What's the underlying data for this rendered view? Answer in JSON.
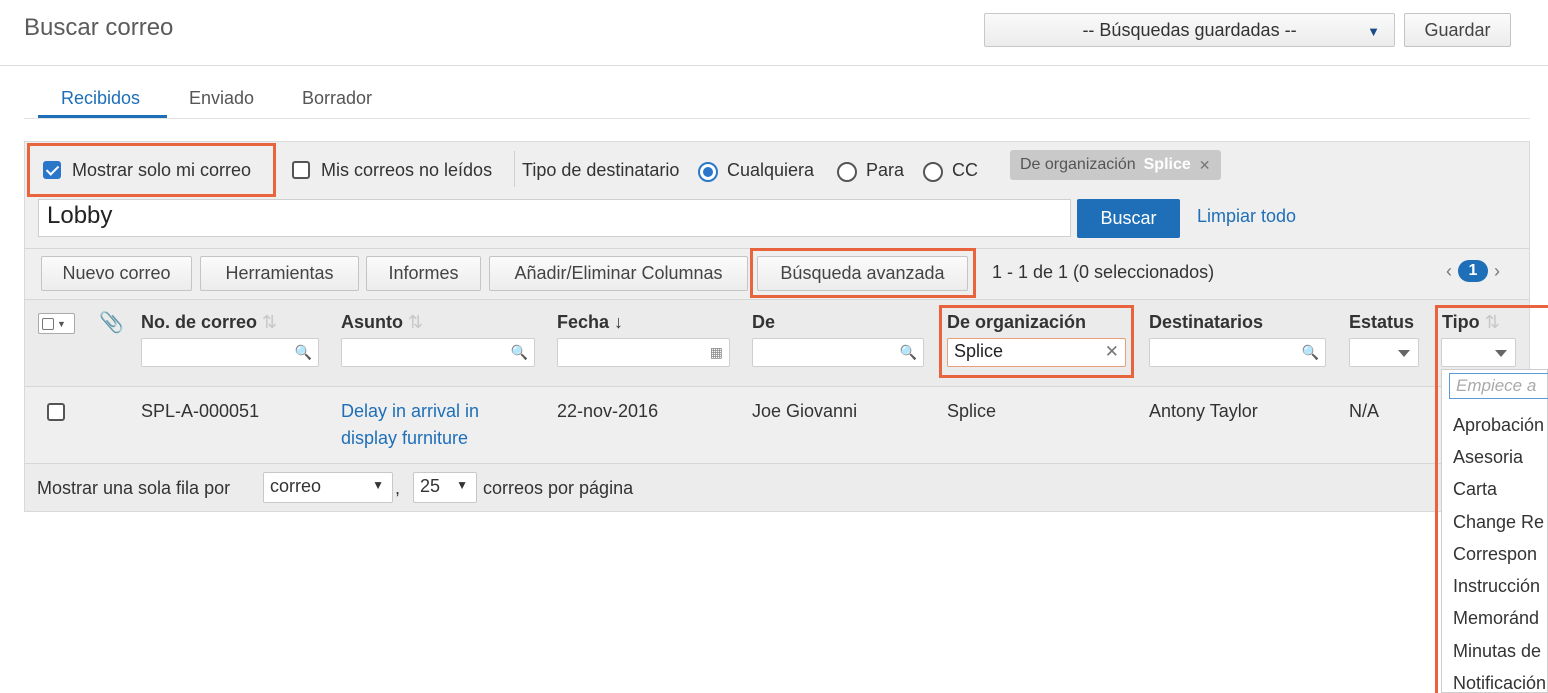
{
  "header": {
    "title": "Buscar correo",
    "saved_searches": "-- Búsquedas guardadas --",
    "save_label": "Guardar"
  },
  "tabs": [
    {
      "label": "Recibidos",
      "active": true
    },
    {
      "label": "Enviado",
      "active": false
    },
    {
      "label": "Borrador",
      "active": false
    }
  ],
  "filters": {
    "only_mine": {
      "label": "Mostrar solo mi correo",
      "checked": true
    },
    "unread": {
      "label": "Mis correos no leídos",
      "checked": false
    },
    "recipient_type_label": "Tipo de destinatario",
    "recipient_options": [
      {
        "label": "Cualquiera",
        "selected": true
      },
      {
        "label": "Para",
        "selected": false
      },
      {
        "label": "CC",
        "selected": false
      }
    ],
    "chip": {
      "key": "De organización",
      "value": "Splice"
    },
    "search_value": "Lobby",
    "search_button": "Buscar",
    "clear_all": "Limpiar todo"
  },
  "toolbar": {
    "new_mail": "Nuevo correo",
    "tools": "Herramientas",
    "reports": "Informes",
    "columns": "Añadir/Eliminar Columnas",
    "advanced": "Búsqueda avanzada",
    "count": "1 - 1 de 1 (0 seleccionados)",
    "page": "1"
  },
  "table": {
    "headers": {
      "number": "No. de correo",
      "subject": "Asunto",
      "date": "Fecha",
      "from": "De",
      "org": "De organización",
      "recipients": "Destinatarios",
      "status": "Estatus",
      "type": "Tipo"
    },
    "org_filter_value": "Splice",
    "rows": [
      {
        "number": "SPL-A-000051",
        "subject": "Delay in arrival in display furniture",
        "date": "22-nov-2016",
        "from": "Joe Giovanni",
        "org": "Splice",
        "recipients": "Antony Taylor",
        "status": "N/A"
      }
    ]
  },
  "footer": {
    "show_one_row": "Mostrar una sola fila por",
    "row_unit": "correo",
    "comma": ",",
    "per_page": "25",
    "per_page_label": "correos por página"
  },
  "type_dropdown": {
    "placeholder": "Empiece a",
    "items": [
      "Aprobación",
      "Asesoria",
      "Carta",
      "Change Re",
      "Correspon",
      "Instrucción",
      "Memoránd",
      "Minutas de",
      "Notificación"
    ]
  },
  "colors": {
    "accent": "#1e6fb8",
    "highlight": "#e8643c"
  }
}
